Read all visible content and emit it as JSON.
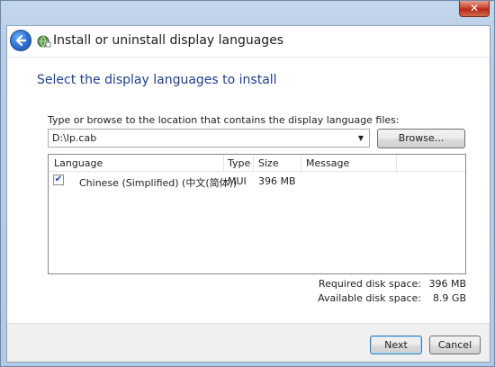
{
  "window": {
    "title": "Install or uninstall display languages",
    "close_label": "✕"
  },
  "heading": "Select the display languages to install",
  "instruction": "Type or browse to the location that contains the display language files:",
  "path": {
    "value": "D:\\lp.cab"
  },
  "browse_label": "Browse...",
  "list": {
    "columns": [
      "Language",
      "Type",
      "Size",
      "Message"
    ],
    "rows": [
      {
        "checked": true,
        "language": "Chinese (Simplified) (中文(简体))",
        "type": "MUI",
        "size": "396 MB",
        "message": ""
      }
    ]
  },
  "disk": {
    "required_label": "Required disk space:",
    "required_value": "396 MB",
    "available_label": "Available disk space:",
    "available_value": "8.9 GB"
  },
  "buttons": {
    "next": "Next",
    "cancel": "Cancel"
  },
  "icons": {
    "back": "back-arrow-icon",
    "app": "language-globe-icon",
    "close": "close-icon"
  }
}
